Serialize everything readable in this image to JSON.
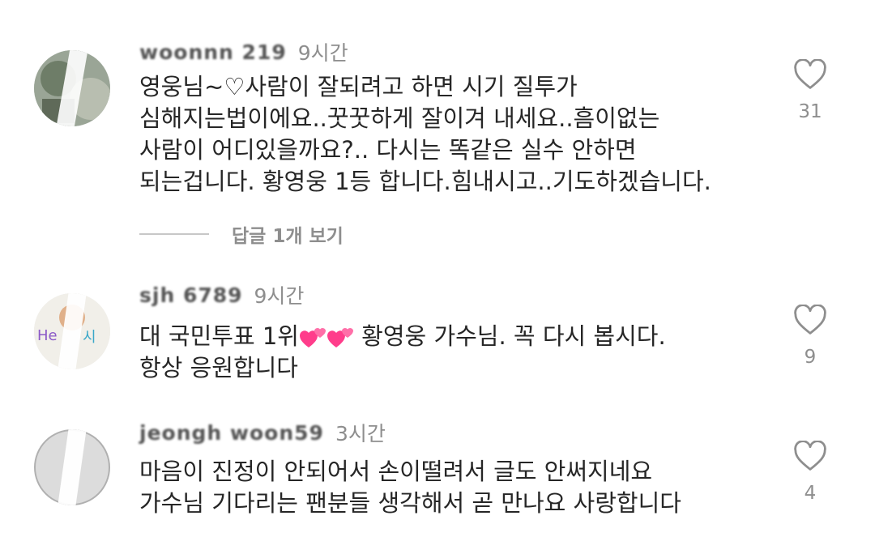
{
  "comments": [
    {
      "username": "woonnn 219",
      "time": "9시간",
      "lines": [
        "영웅님~♡사람이 잘되려고 하면 시기 질투가",
        "심해지는법이에요..꿋꿋하게 잘이겨 내세요..흠이없는",
        "사람이 어디있을까요?.. 다시는 똑같은 실수 안하면",
        "되는겁니다. 황영웅 1등 합니다.힘내시고..기도하겠습니다."
      ],
      "likes": "31",
      "replies_label": "답글 1개 보기"
    },
    {
      "username": "sjh 6789",
      "time": "9시간",
      "line1_a": "대 국민투표 1위",
      "line1_b": " 황영웅 가수님.  꼭 다시 봅시다.",
      "line2": "항상 응원합니다",
      "likes": "9"
    },
    {
      "username": "jeongh woon59",
      "time": "3시간",
      "lines": [
        "마음이 진정이 안되어서 손이떨려서 글도 안써지네요",
        "가수님 기다리는 팬분들 생각해서 곧 만나요 사랑합니다"
      ],
      "likes": "4"
    }
  ],
  "colors": {
    "text": "#262626",
    "muted": "#8e8e8e",
    "emoji_heart": "#ff3d8b"
  }
}
